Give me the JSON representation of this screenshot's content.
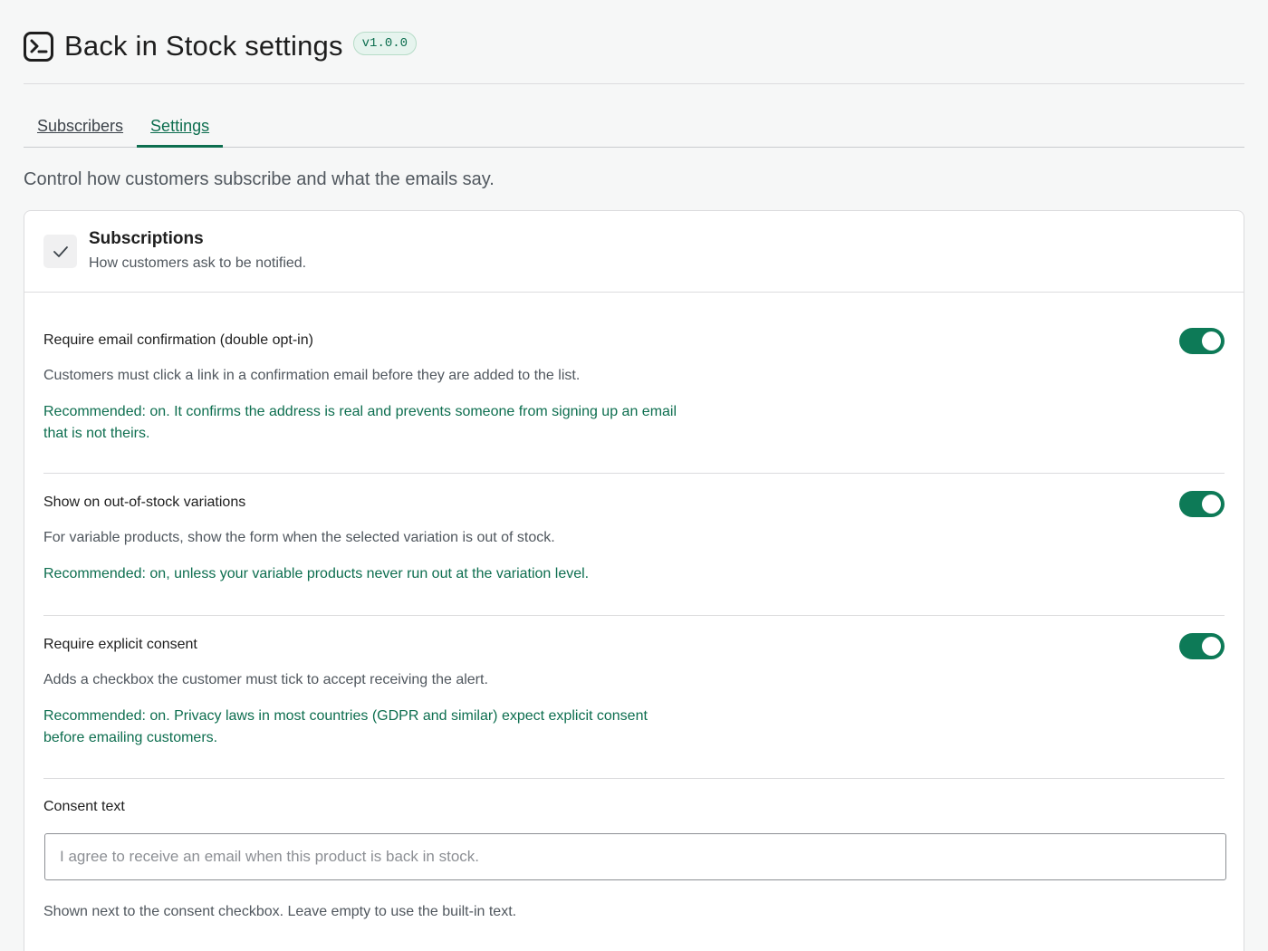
{
  "header": {
    "title": "Back in Stock settings",
    "version": "v1.0.0",
    "icon": "terminal-icon"
  },
  "tabs": [
    {
      "label": "Subscribers",
      "active": false
    },
    {
      "label": "Settings",
      "active": true
    }
  ],
  "intro": "Control how customers subscribe and what the emails say.",
  "section": {
    "icon": "checkmark-icon",
    "title": "Subscriptions",
    "subtitle": "How customers ask to be notified."
  },
  "settings": [
    {
      "label": "Require email confirmation (double opt-in)",
      "description": "Customers must click a link in a confirmation email before they are added to the list.",
      "recommendation": "Recommended: on. It confirms the address is real and prevents someone from signing up an email that is not theirs.",
      "enabled": true
    },
    {
      "label": "Show on out-of-stock variations",
      "description": "For variable products, show the form when the selected variation is out of stock.",
      "recommendation": "Recommended: on, unless your variable products never run out at the variation level.",
      "enabled": true
    },
    {
      "label": "Require explicit consent",
      "description": "Adds a checkbox the customer must tick to accept receiving the alert.",
      "recommendation": "Recommended: on. Privacy laws in most countries (GDPR and similar) expect explicit consent before emailing customers.",
      "enabled": true
    }
  ],
  "consent": {
    "label": "Consent text",
    "value": "",
    "placeholder": "I agree to receive an email when this product is back in stock.",
    "help": "Shown next to the consent checkbox. Leave empty to use the built-in text."
  },
  "colors": {
    "accent": "#0d7a57",
    "recommendation_text": "#0d6e4f",
    "background": "#f6f7f7"
  }
}
